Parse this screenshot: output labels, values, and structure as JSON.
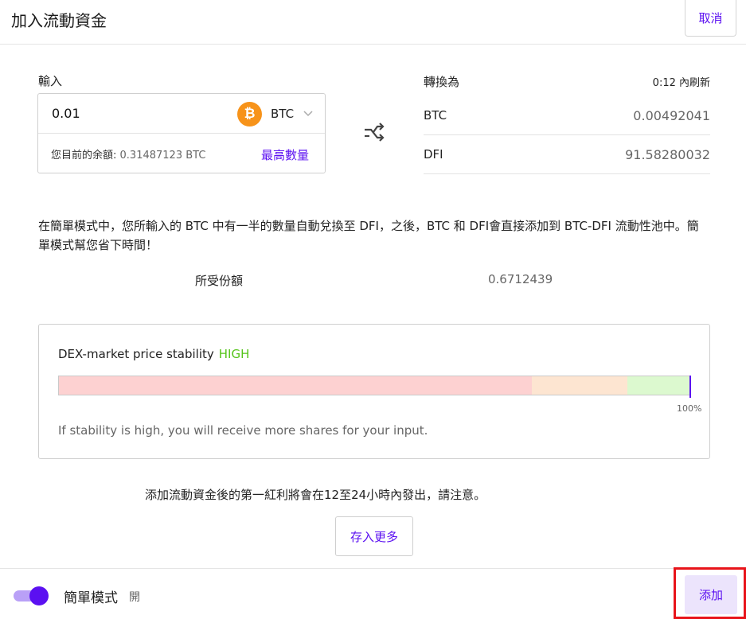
{
  "header": {
    "title": "加入流動資金",
    "cancel_label": "取消"
  },
  "input": {
    "label": "輸入",
    "amount": "0.01",
    "token": "BTC",
    "token_icon": "bitcoin-icon",
    "balance_label": "您目前的余額:",
    "balance_value": "0.31487123 BTC",
    "max_label": "最高數量"
  },
  "conversion": {
    "title": "轉換為",
    "refresh": "0:12 內刷新",
    "rows": [
      {
        "symbol": "BTC",
        "value": "0.00492041"
      },
      {
        "symbol": "DFI",
        "value": "91.58280032"
      }
    ]
  },
  "description": "在簡單模式中，您所輸入的 BTC 中有一半的數量自動兌換至 DFI，之後，BTC 和 DFI會直接添加到 BTC-DFI 流動性池中。簡單模式幫您省下時間！",
  "share": {
    "label": "所受份額",
    "value": "0.6712439"
  },
  "stability": {
    "title": "DEX-market price stability",
    "level": "HIGH",
    "level_color": "#55c41a",
    "percent_label": "100%",
    "percent_value": 100,
    "segments": [
      {
        "color": "#fdd1d1",
        "fraction": 0.749
      },
      {
        "color": "#fde5d1",
        "fraction": 0.151
      },
      {
        "color": "#dcf9cf",
        "fraction": 0.1
      }
    ],
    "note": "If stability is high, you will receive more shares for your input."
  },
  "notice": "添加流動資金後的第一紅利將會在12至24小時內發出，請注意。",
  "deposit_more_label": "存入更多",
  "footer": {
    "mode_label": "簡單模式",
    "mode_state": "開",
    "toggle_on": true,
    "add_label": "添加"
  },
  "colors": {
    "accent": "#5b10f1",
    "highlight": "#e8141a"
  }
}
